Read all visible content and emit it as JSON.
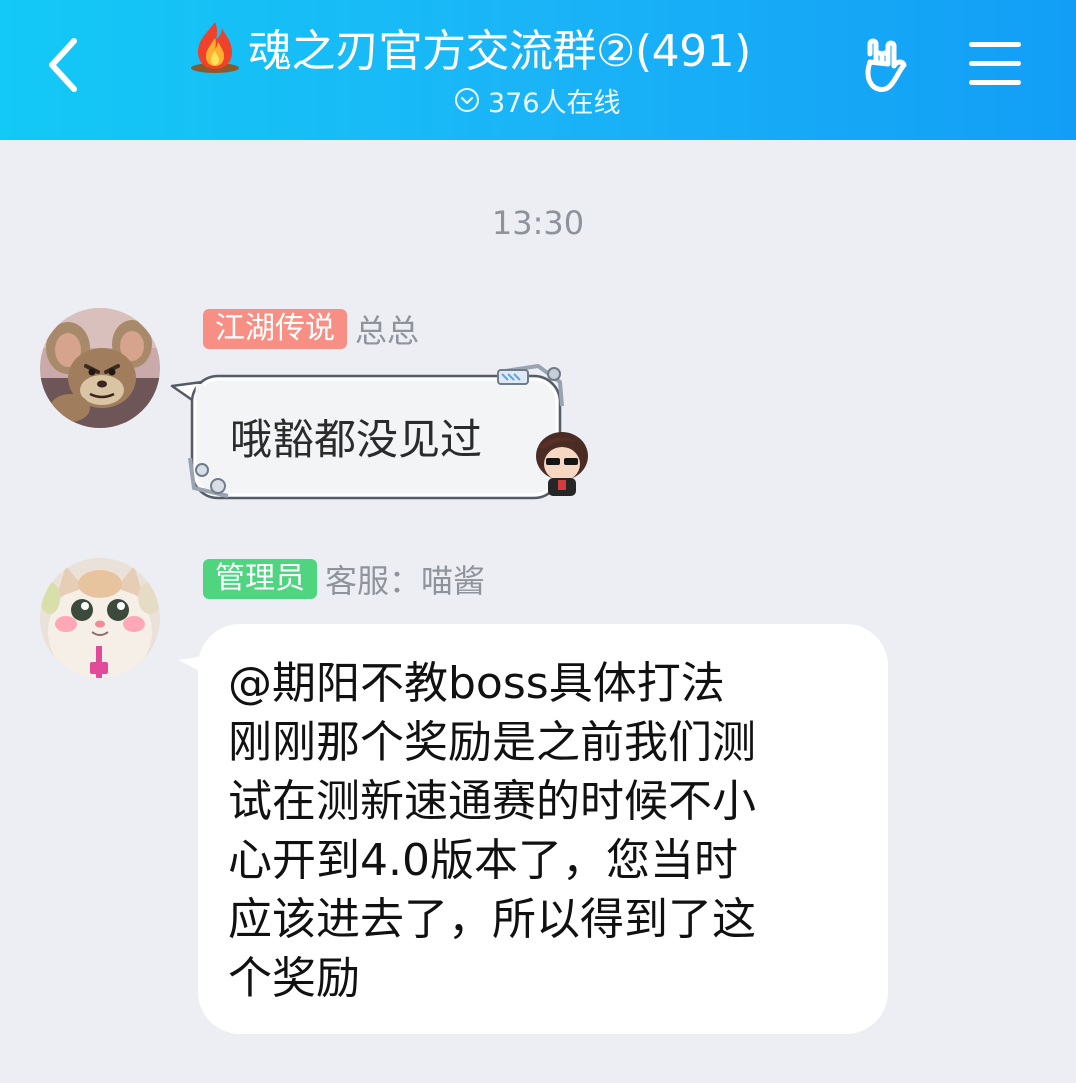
{
  "header": {
    "title": "魂之刃官方交流群②(491)",
    "online_text": "376人在线",
    "icons": {
      "back": "chevron-left-icon",
      "title_emoji": "fire-icon",
      "online": "chevron-down-circle-icon",
      "hand": "rock-hand-icon",
      "menu": "hamburger-menu-icon"
    },
    "colors": {
      "gradient_start": "#13c9f6",
      "gradient_end": "#129ef6"
    }
  },
  "chat": {
    "timestamp": "13:30",
    "messages": [
      {
        "badge": "江湖传说",
        "badge_color": "#f88f84",
        "sender": "总总",
        "text": "哦豁都没见过",
        "avatar": "cartoon-mouse-avatar",
        "bubble_style": "decorated"
      },
      {
        "badge": "管理员",
        "badge_color": "#4fd47f",
        "sender": "客服：喵酱",
        "text": "@期阳不教boss具体打法\n刚刚那个奖励是之前我们测\n试在测新速通赛的时候不小\n心开到4.0版本了，您当时\n应该进去了，所以得到了这\n个奖励",
        "avatar": "kitten-avatar",
        "bubble_style": "plain"
      }
    ]
  }
}
